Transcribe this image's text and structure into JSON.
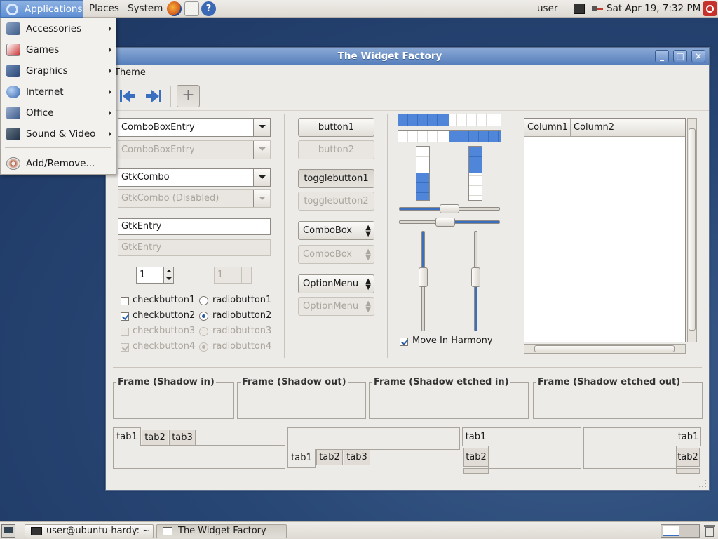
{
  "top_panel": {
    "menus": [
      "Applications",
      "Places",
      "System"
    ],
    "user": "user",
    "clock": "Sat Apr 19,  7:32 PM"
  },
  "apps_menu": {
    "items": [
      {
        "label": "Accessories",
        "icon": "accessories-icon",
        "submenu": true
      },
      {
        "label": "Games",
        "icon": "games-icon",
        "submenu": true
      },
      {
        "label": "Graphics",
        "icon": "graphics-icon",
        "submenu": true
      },
      {
        "label": "Internet",
        "icon": "internet-icon",
        "submenu": true
      },
      {
        "label": "Office",
        "icon": "office-icon",
        "submenu": true
      },
      {
        "label": "Sound & Video",
        "icon": "sound-video-icon",
        "submenu": true
      },
      {
        "label": "Add/Remove...",
        "icon": "add-remove-icon",
        "submenu": false
      }
    ]
  },
  "window": {
    "title": "The Widget Factory",
    "menubar": [
      "Theme"
    ],
    "combo_entry": "ComboBoxEntry",
    "combo_entry_disabled": "ComboBoxEntry",
    "gtk_combo": "GtkCombo",
    "gtk_combo_disabled": "GtkCombo (Disabled)",
    "gtk_entry": "GtkEntry",
    "gtk_entry_disabled": "GtkEntry",
    "spin_value": "1",
    "spin_value_disabled": "1",
    "checks": [
      "checkbutton1",
      "checkbutton2",
      "checkbutton3",
      "checkbutton4"
    ],
    "radios": [
      "radiobutton1",
      "radiobutton2",
      "radiobutton3",
      "radiobutton4"
    ],
    "buttons": {
      "button1": "button1",
      "button2": "button2",
      "toggle1": "togglebutton1",
      "toggle2": "togglebutton2",
      "combobox": "ComboBox",
      "combobox_disabled": "ComboBox",
      "optionmenu": "OptionMenu",
      "optionmenu_disabled": "OptionMenu"
    },
    "progress": {
      "h1": 0.5,
      "h2": 0.5,
      "v1": 0.5,
      "v2": 0.5
    },
    "scales": {
      "h1": 0.5,
      "h2": 0.45,
      "v1": 0.45,
      "v2": 0.45
    },
    "harmony": "Move In Harmony",
    "tree_columns": [
      "Column1",
      "Column2"
    ],
    "frames": [
      "Frame (Shadow in)",
      "Frame (Shadow out)",
      "Frame (Shadow etched in)",
      "Frame (Shadow etched out)"
    ],
    "tabs": [
      "tab1",
      "tab2",
      "tab3"
    ]
  },
  "taskbar": {
    "tasks": [
      "user@ubuntu-hardy: ~",
      "The Widget Factory"
    ]
  },
  "colors": {
    "accent": "#3a6fbf",
    "panel": "#dedad3",
    "window_bg": "#edebe7"
  }
}
